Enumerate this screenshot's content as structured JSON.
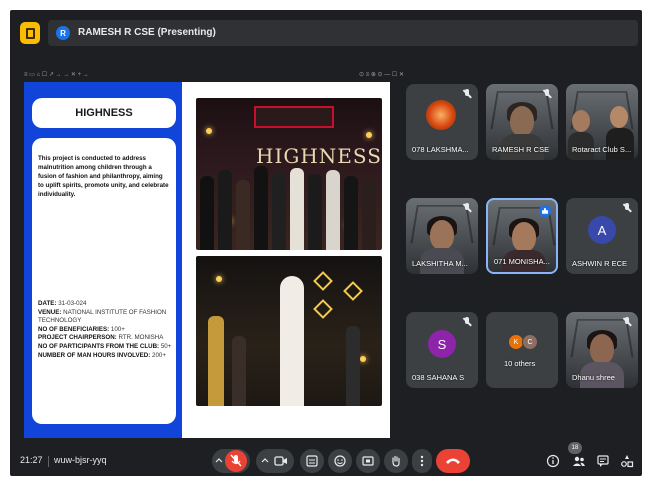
{
  "header": {
    "presenter_initial": "R",
    "presenting_label": "RAMESH R CSE (Presenting)"
  },
  "screen_toolbar": {
    "left_text": "≡ ▭  ⌂  ☐ ↗ → →  ✕  + →",
    "right_text": "⊙ ≡ ⊕ ⊙  —  ☐  ✕"
  },
  "slide": {
    "heading": "HIGHNESS",
    "description": "This project is conducted to address malnutrition among children through a fusion of fashion and philanthropy, aiming to uplift spirits, promote unity, and celebrate individuality.",
    "photo_sign": "HIGHNESS",
    "facts": [
      {
        "label": "DATE:",
        "value": "31-03-024"
      },
      {
        "label": "VENUE:",
        "value": "NATIONAL INSTITUTE OF FASHION TECHNOLOGY"
      },
      {
        "label": "NO OF BENEFICIARIES:",
        "value": "100+"
      },
      {
        "label": "PROJECT CHAIRPERSON:",
        "value": "RTR. MONISHA"
      },
      {
        "label": "NO OF PARTICIPANTS FROM THE CLUB:",
        "value": "50+"
      },
      {
        "label": "NUMBER OF MAN HOURS INVOLVED:",
        "value": "200+"
      }
    ]
  },
  "participants": [
    {
      "name": "078 LAKSHMA...",
      "type": "image",
      "muted": true
    },
    {
      "name": "RAMESH R CSE",
      "type": "video",
      "muted": true
    },
    {
      "name": "Rotaract Club S...",
      "type": "video",
      "muted": false
    },
    {
      "name": "LAKSHITHA M...",
      "type": "video",
      "muted": true
    },
    {
      "name": "071 MONISHA...",
      "type": "video",
      "muted": false,
      "speaking": true
    },
    {
      "name": "ASHWIN R ECE",
      "type": "avatar",
      "initial": "A",
      "muted": true
    },
    {
      "name": "038 SAHANA S",
      "type": "avatar",
      "initial": "S",
      "muted": true
    },
    {
      "name": "10 others",
      "type": "group",
      "initials": [
        "K",
        "C"
      ]
    },
    {
      "name": "Dhanu shree",
      "type": "video",
      "muted": true
    }
  ],
  "footer": {
    "time": "21:27",
    "meeting_code": "wuw-bjsr-yyq",
    "participant_count": "18"
  },
  "colors": {
    "background": "#1e1f22",
    "tile": "#3c4043",
    "accent_blue": "#1a73e8",
    "danger_red": "#ea4335",
    "slide_blue": "#1144d9",
    "avatar_ashwin": "#3949ab",
    "avatar_sahana": "#8e24aa",
    "avatar_k": "#e8710a",
    "avatar_c": "#8d6e63"
  }
}
